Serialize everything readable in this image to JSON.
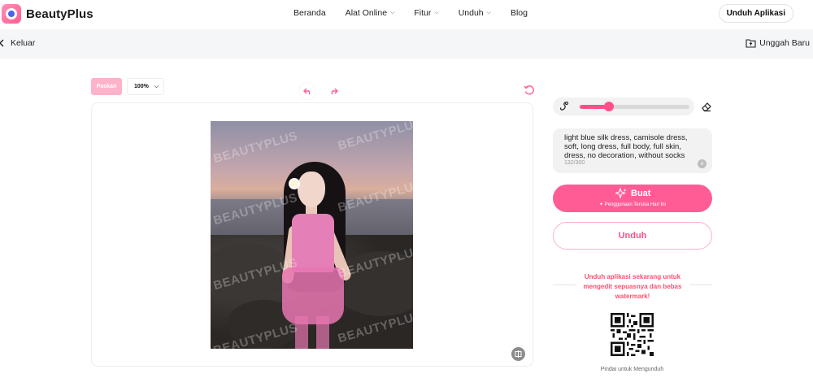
{
  "header": {
    "brand": "BeautyPlus",
    "nav": [
      {
        "label": "Beranda",
        "has_dropdown": false
      },
      {
        "label": "Alat Online",
        "has_dropdown": true
      },
      {
        "label": "Fitur",
        "has_dropdown": true
      },
      {
        "label": "Unduh",
        "has_dropdown": true
      },
      {
        "label": "Blog",
        "has_dropdown": false
      }
    ],
    "download_app": "Unduh Aplikasi"
  },
  "subbar": {
    "exit": "Keluar",
    "upload_new": "Unggah Baru"
  },
  "toolbar": {
    "fit_label": "Paskan",
    "zoom": "100%"
  },
  "canvas": {
    "watermark": "BEAUTYPLUS"
  },
  "brush": {
    "size_fraction": 0.27
  },
  "prompt": {
    "text": "light blue silk dress, camisole dress, soft,  long dress, full body, full skin, dress, no decoration, without socks",
    "counter": "132/300"
  },
  "actions": {
    "generate": "Buat",
    "generate_sub": "Penggunaan Tersisa Hari Ini",
    "download": "Unduh"
  },
  "promo": {
    "text": "Unduh aplikasi sekarang untuk mengedit sepuasnya dan bebas watermark!",
    "qr_caption": "Pindai untuk Mengunduh"
  },
  "colors": {
    "accent": "#ff5c96",
    "accent_light": "#ffb3cb",
    "promo": "#ff4f6f"
  }
}
